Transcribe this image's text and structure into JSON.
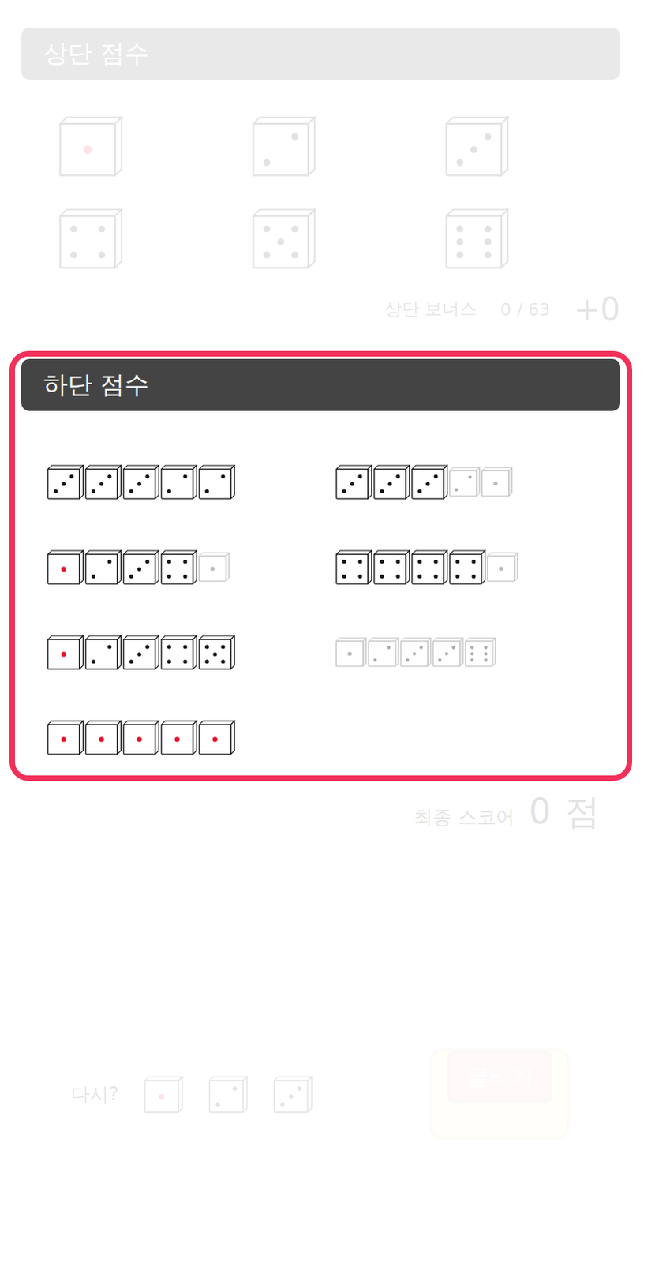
{
  "upper": {
    "title": "상단 점수",
    "faded": true,
    "categories": [
      {
        "face": 1
      },
      {
        "face": 2
      },
      {
        "face": 3
      },
      {
        "face": 4
      },
      {
        "face": 5
      },
      {
        "face": 6
      }
    ],
    "bonus": {
      "label": "상단 보너스",
      "reading": "0 / 63",
      "value": "+0"
    }
  },
  "lower": {
    "title": "하단 점수",
    "highlighted": true,
    "combos": [
      {
        "dice": [
          {
            "face": 3,
            "faded": false
          },
          {
            "face": 3,
            "faded": false
          },
          {
            "face": 3,
            "faded": false
          },
          {
            "face": 2,
            "faded": false
          },
          {
            "face": 2,
            "faded": false
          }
        ]
      },
      {
        "dice": [
          {
            "face": 3,
            "faded": false
          },
          {
            "face": 3,
            "faded": false
          },
          {
            "face": 3,
            "faded": false
          },
          {
            "face": 2,
            "faded": true
          },
          {
            "face": 1,
            "faded": true
          }
        ]
      },
      {
        "dice": [
          {
            "face": 1,
            "faded": false
          },
          {
            "face": 2,
            "faded": false
          },
          {
            "face": 3,
            "faded": false
          },
          {
            "face": 4,
            "faded": false
          },
          {
            "face": 1,
            "faded": true
          }
        ]
      },
      {
        "dice": [
          {
            "face": 4,
            "faded": false
          },
          {
            "face": 4,
            "faded": false
          },
          {
            "face": 4,
            "faded": false
          },
          {
            "face": 4,
            "faded": false
          },
          {
            "face": 1,
            "faded": true
          }
        ]
      },
      {
        "dice": [
          {
            "face": 1,
            "faded": false
          },
          {
            "face": 2,
            "faded": false
          },
          {
            "face": 3,
            "faded": false
          },
          {
            "face": 4,
            "faded": false
          },
          {
            "face": 5,
            "faded": false
          }
        ]
      },
      {
        "dice": [
          {
            "face": 1,
            "faded": true
          },
          {
            "face": 2,
            "faded": true
          },
          {
            "face": 3,
            "faded": true
          },
          {
            "face": 3,
            "faded": true
          },
          {
            "face": 6,
            "faded": true
          }
        ]
      },
      {
        "dice": [
          {
            "face": 1,
            "faded": false
          },
          {
            "face": 1,
            "faded": false
          },
          {
            "face": 1,
            "faded": false
          },
          {
            "face": 1,
            "faded": false
          },
          {
            "face": 1,
            "faded": false
          }
        ]
      }
    ]
  },
  "final": {
    "label": "최종 스코어",
    "value": "0",
    "unit": "점",
    "faded": true
  },
  "reroll": {
    "label": "다시?",
    "faded": true,
    "dice": [
      {
        "face": 1
      },
      {
        "face": 2
      },
      {
        "face": 3
      }
    ]
  },
  "roll_button": {
    "label": "굴리기",
    "faded": true
  }
}
